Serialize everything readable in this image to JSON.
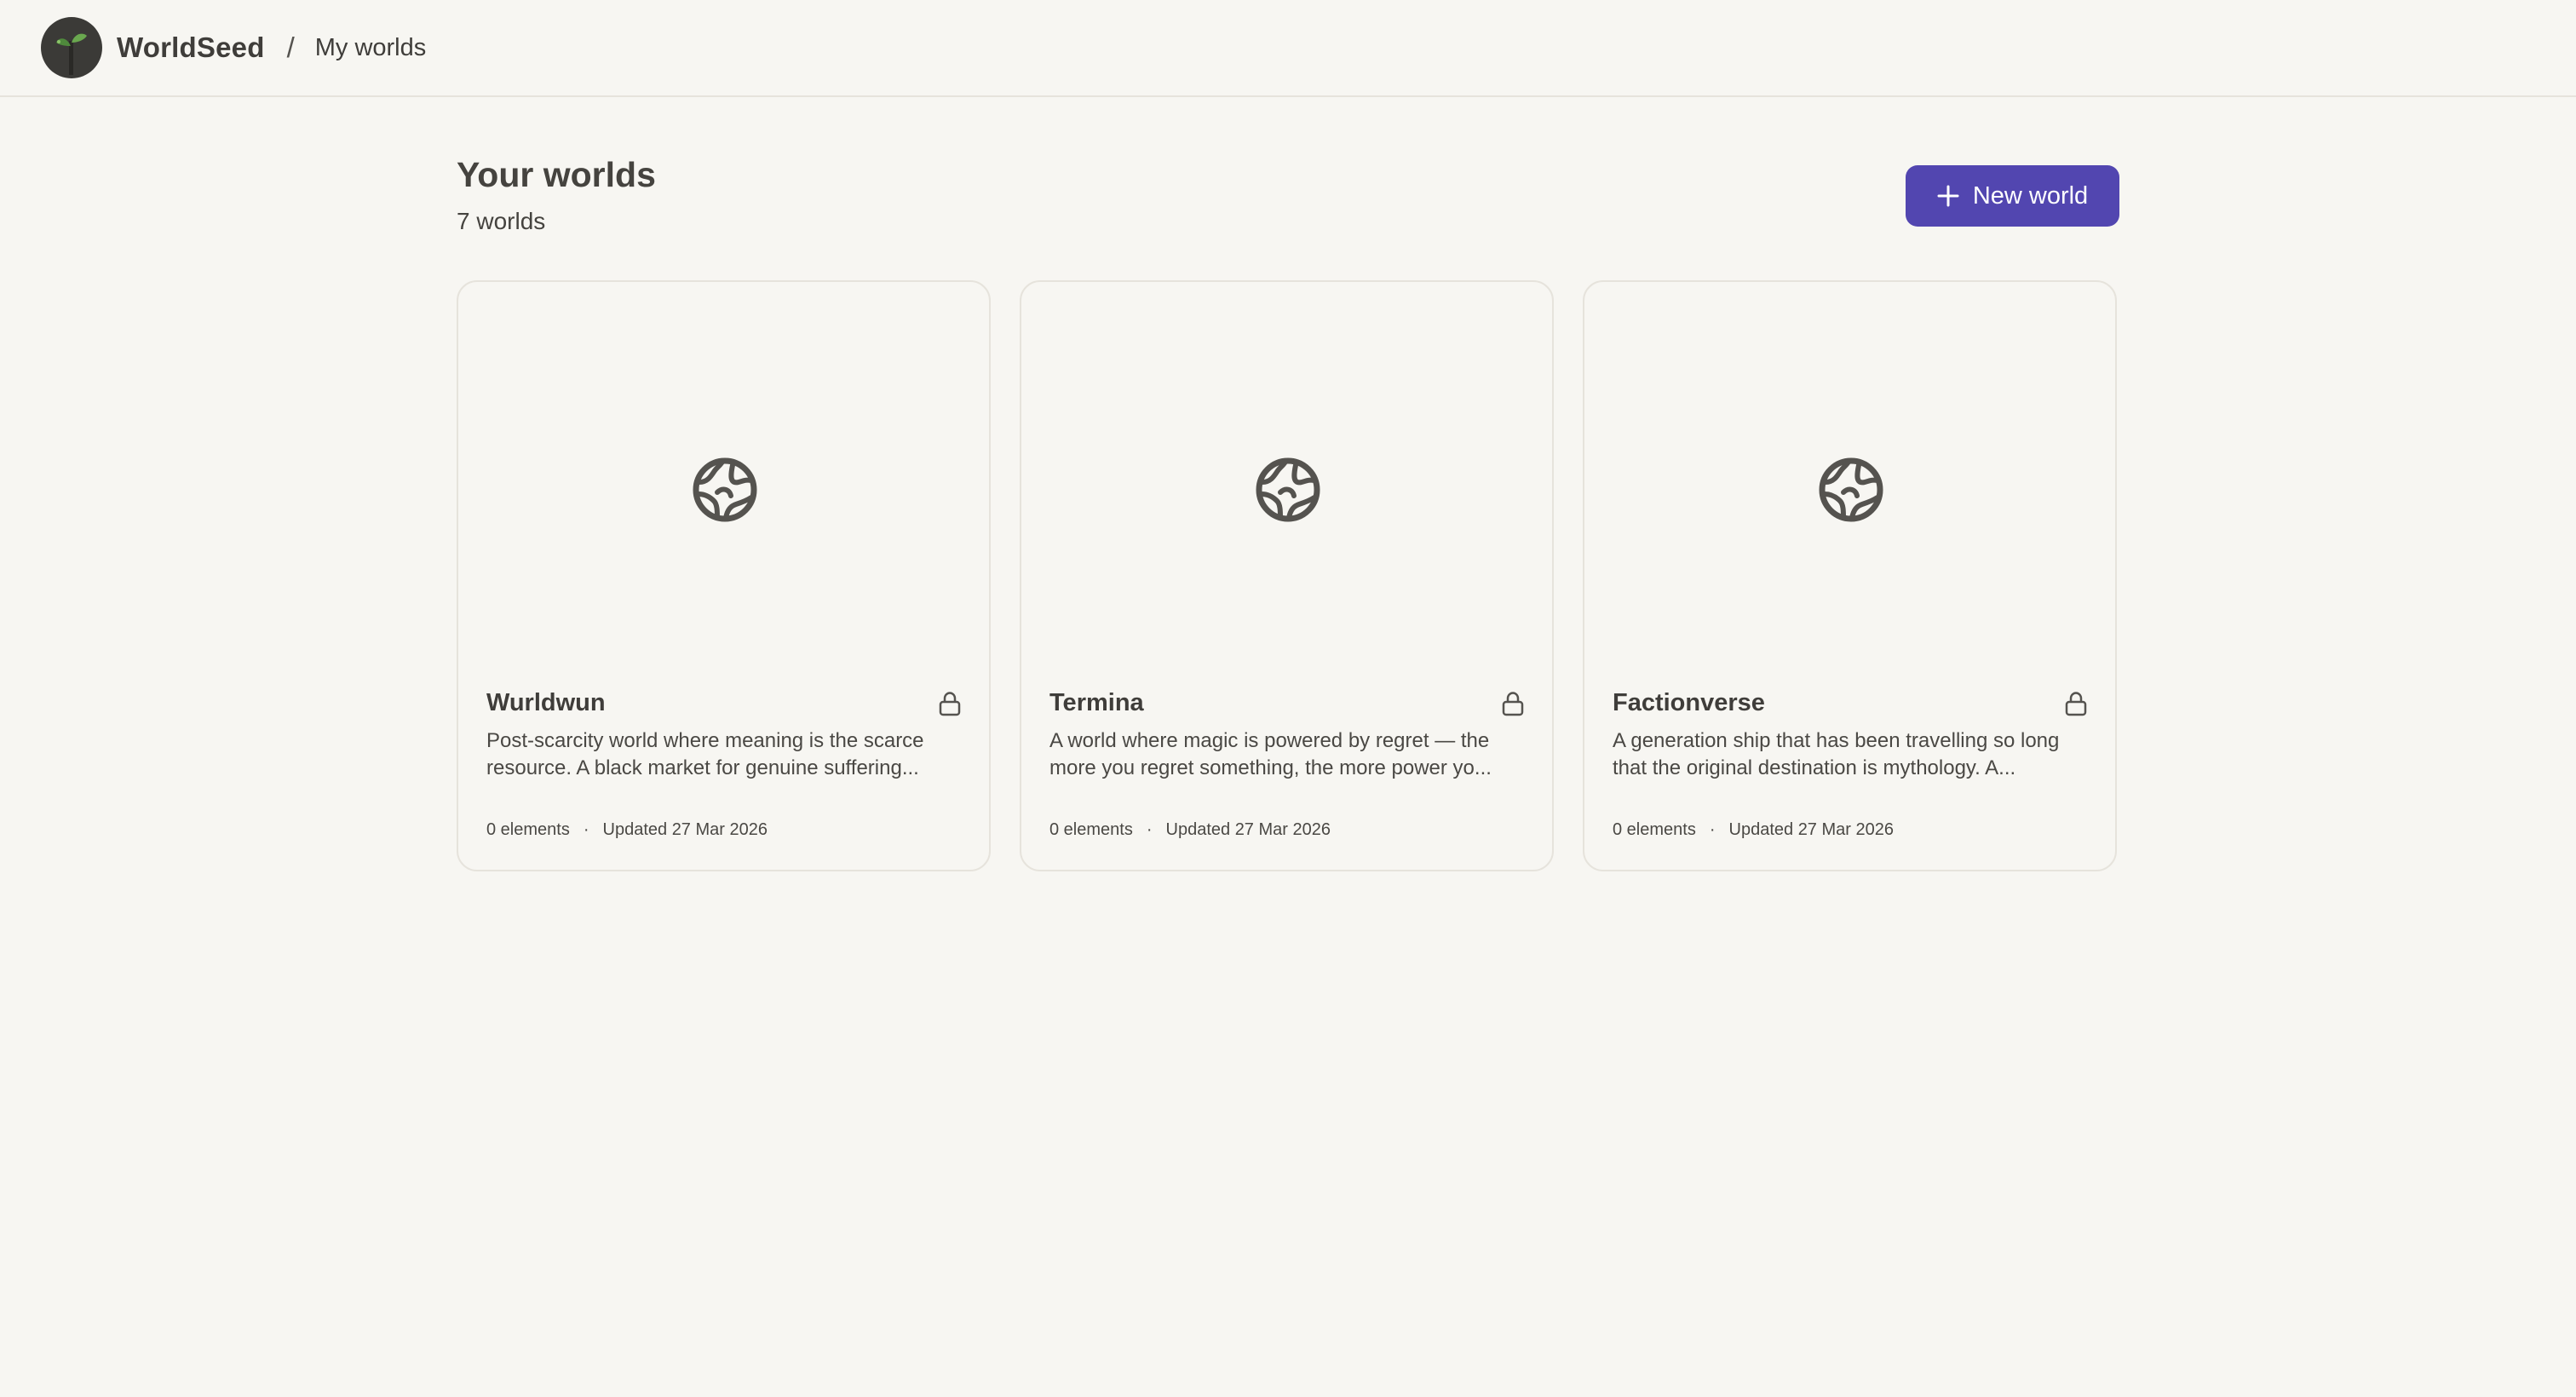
{
  "topbar": {
    "brand": "WorldSeed",
    "separator": "/",
    "breadcrumb": "My worlds",
    "logo_icon": "seedling-logo"
  },
  "header": {
    "title": "Your worlds",
    "count": "7 worlds",
    "new_button_label": "New world",
    "new_button_icon": "plus-icon"
  },
  "colors": {
    "background": "#f7f6f2",
    "accent": "#5246b0",
    "text": "#3f3d3a",
    "border": "#e6e3dc"
  },
  "worlds": [
    {
      "title": "Wurldwun",
      "description": "Post-scarcity world where meaning is the scarce resource. A black market for genuine suffering...",
      "elements": "0 elements",
      "dot": "·",
      "updated": "Updated 27 Mar 2026",
      "icon": "globe-icon",
      "visibility_icon": "lock-icon"
    },
    {
      "title": "Termina",
      "description": "A world where magic is powered by regret — the more you regret something, the more power yo...",
      "elements": "0 elements",
      "dot": "·",
      "updated": "Updated 27 Mar 2026",
      "icon": "globe-icon",
      "visibility_icon": "lock-icon"
    },
    {
      "title": "Factionverse",
      "description": "A generation ship that has been travelling so long that the original destination is mythology. A...",
      "elements": "0 elements",
      "dot": "·",
      "updated": "Updated 27 Mar 2026",
      "icon": "globe-icon",
      "visibility_icon": "lock-icon"
    }
  ]
}
